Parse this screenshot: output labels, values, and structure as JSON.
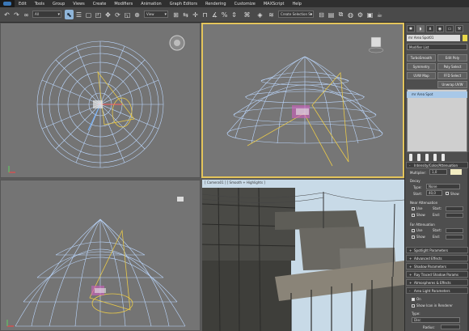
{
  "menu": [
    "Edit",
    "Tools",
    "Group",
    "Views",
    "Create",
    "Modifiers",
    "Animation",
    "Graph Editors",
    "Rendering",
    "Customize",
    "MAXScript",
    "Help"
  ],
  "toolbar": {
    "selection_filter": "All",
    "ref_coord": "View",
    "selection_set": "Create Selection Se",
    "icons": [
      "undo-icon",
      "redo-icon",
      "link-icon",
      "unlink-icon",
      "bind-space-warp-icon",
      "select-icon",
      "select-by-name-icon",
      "rect-region-icon",
      "window-crossing-icon",
      "move-icon",
      "rotate-icon",
      "scale-icon",
      "pivot-icon",
      "mirror-icon",
      "align-icon",
      "snaps-icon",
      "angle-snap-icon",
      "percent-snap-icon",
      "spinner-snap-icon",
      "named-selections-icon",
      "layer-manager-icon",
      "curve-editor-icon",
      "schematic-view-icon",
      "material-editor-icon",
      "render-setup-icon",
      "render-frame-icon",
      "quick-render-icon"
    ]
  },
  "viewports": {
    "perspective_label": "[ Camera01 ] [ Smooth + Highlights ]"
  },
  "panel": {
    "object_name": "mr Area Spot01",
    "modifier_list": "Modifier List",
    "buttons": [
      "TurboSmooth",
      "Edit Poly",
      "Symmetry",
      "Poly Select",
      "UVW Map",
      "FFD Select",
      "Unwrap UVW"
    ],
    "stack_item": "mr Area Spot",
    "rollouts": {
      "intensity": "Intensity/Color/Attenuation",
      "multiplier_label": "Multiplier:",
      "multiplier_value": "1,0",
      "decay_label": "Decay",
      "type_label": "Type:",
      "type_value": "None",
      "start_label": "Start:",
      "start_value": "40,0",
      "show_label": "Show",
      "near_atten": "Near Attenuation",
      "use_label": "Use",
      "start2": "Start:",
      "show2": "Show",
      "end_label": "End:",
      "far_atten": "Far Attenuation",
      "use3": "Use",
      "start3": "Start:",
      "show3": "Show",
      "end3": "End:",
      "spotlight": "Spotlight Parameters",
      "advanced": "Advanced Effects",
      "shadow": "Shadow Parameters",
      "raytraced": "Ray Traced Shadow Params",
      "atmos": "Atmospheres & Effects",
      "area_light": "Area Light Parameters",
      "on_label": "On",
      "show_icon": "Show Icon in Renderer",
      "type2_label": "Type:",
      "type2_value": "Disc",
      "radius_label": "Radius:"
    }
  }
}
